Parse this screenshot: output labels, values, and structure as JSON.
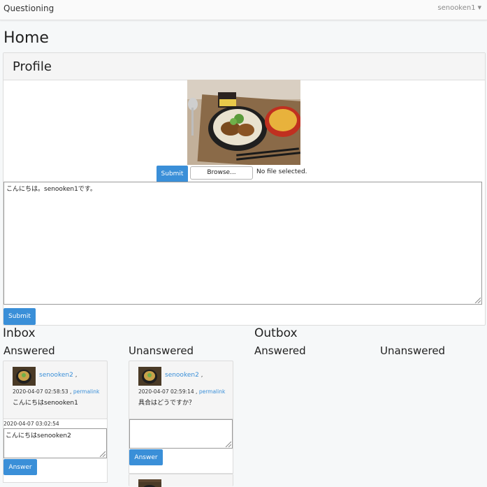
{
  "navbar": {
    "brand": "Questioning",
    "user": "senooken1"
  },
  "page": {
    "title": "Home"
  },
  "profile": {
    "heading": "Profile",
    "submit_label": "Submit",
    "browse_label": "Browse...",
    "file_status": "No file selected.",
    "bio_text": "こんにちは。senooken1です。",
    "bio_submit_label": "Submit"
  },
  "inbox": {
    "title": "Inbox",
    "answered_heading": "Answered",
    "unanswered_heading": "Unanswered",
    "answered": [
      {
        "user": "senooken2",
        "time": "2020-04-07 02:58:53",
        "permalink": "permalink",
        "question": "こんにちはsenooken1",
        "answer_time": "2020-04-07 03:02:54",
        "answer_text": "こんにちはsenooken2",
        "answer_label": "Answer"
      }
    ],
    "unanswered": [
      {
        "user": "senooken2",
        "time": "2020-04-07 02:59:14",
        "permalink": "permalink",
        "question": "具合はどうですか？",
        "answer_text": "",
        "answer_label": "Answer"
      }
    ]
  },
  "outbox": {
    "title": "Outbox",
    "answered_heading": "Answered",
    "unanswered_heading": "Unanswered"
  },
  "colors": {
    "accent": "#3a8fd8",
    "panel_bg": "#f5f5f5"
  }
}
